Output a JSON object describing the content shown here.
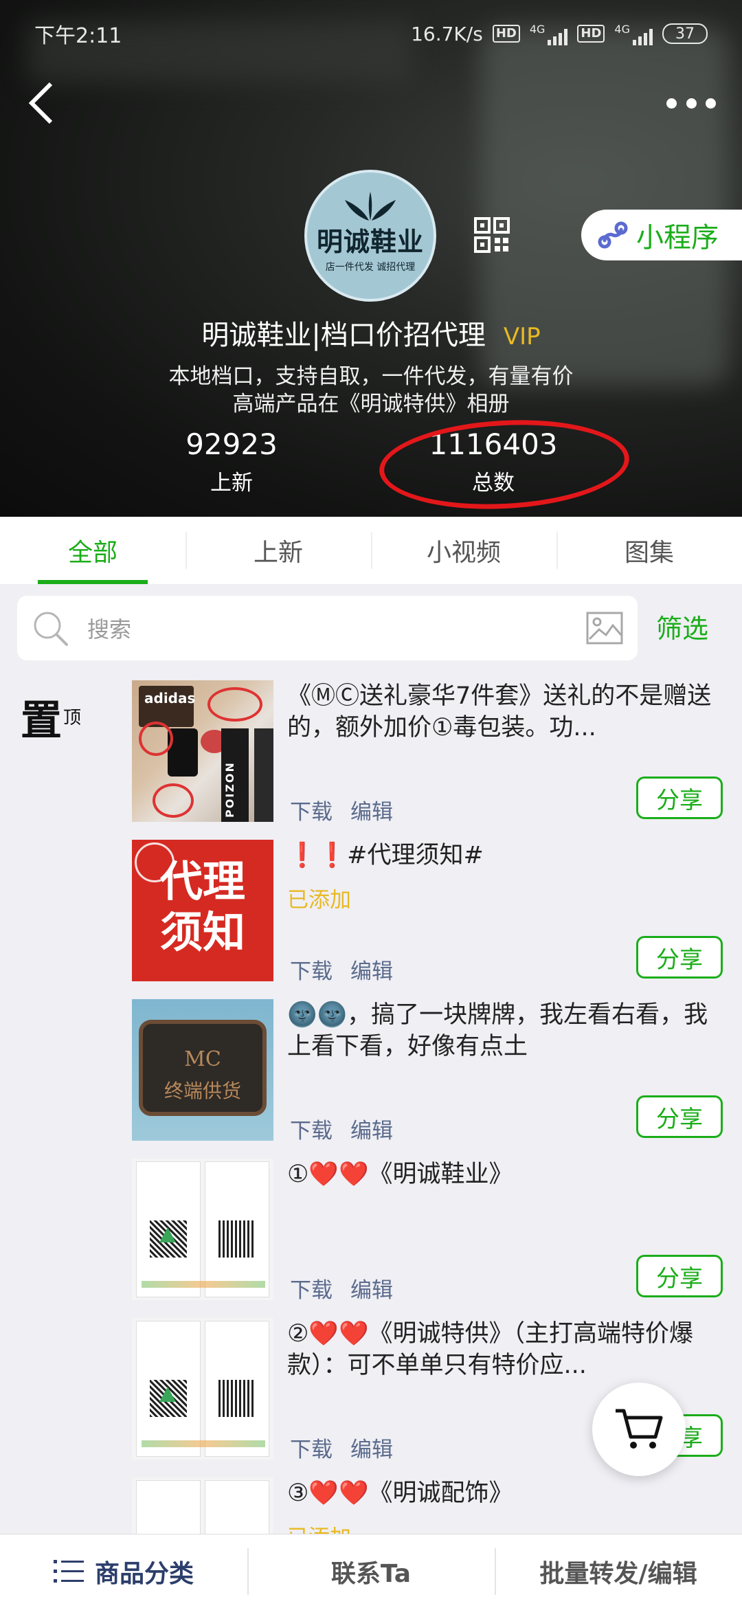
{
  "status_bar": {
    "time": "下午2:11",
    "net_speed": "16.7K/s",
    "hd1": "HD",
    "net1": "4G",
    "hd2": "HD",
    "net2": "4G",
    "battery": "37"
  },
  "shop": {
    "logo_name": "明诚鞋业",
    "logo_sub": "店一件代发   诚招代理",
    "name": "明诚鞋业|档口价招代理",
    "badge": "VIP",
    "desc_line1": "本地档口，支持自取，一件代发，有量有价",
    "desc_line2": "高端产品在《明诚特供》相册",
    "mini_program_label": "小程序"
  },
  "stats": [
    {
      "value": "92923",
      "label": "上新"
    },
    {
      "value": "1116403",
      "label": "总数"
    }
  ],
  "tabs": [
    {
      "label": "全部",
      "active": true
    },
    {
      "label": "上新",
      "active": false
    },
    {
      "label": "小视频",
      "active": false
    },
    {
      "label": "图集",
      "active": false
    }
  ],
  "search": {
    "placeholder": "搜索",
    "filter_label": "筛选"
  },
  "pin": {
    "big": "置",
    "small": "顶"
  },
  "items": [
    {
      "title": "《ⓂⒸ送礼豪华7件套》送礼的不是赠送的，额外加价①毒包装。功...",
      "added": "",
      "download": "下载",
      "edit": "编辑",
      "share": "分享"
    },
    {
      "title": "❗❗#代理须知#",
      "added": "已添加",
      "download": "下载",
      "edit": "编辑",
      "share": "分享"
    },
    {
      "title": "🌚🌚，搞了一块牌牌，我左看右看，我上看下看，好像有点土",
      "added": "",
      "download": "下载",
      "edit": "编辑",
      "share": "分享"
    },
    {
      "title": "①❤️❤️《明诚鞋业》",
      "added": "",
      "download": "下载",
      "edit": "编辑",
      "share": "分享"
    },
    {
      "title": "②❤️❤️《明诚特供》（主打高端特价爆款）：可不单单只有特价应...",
      "added": "",
      "download": "下载",
      "edit": "编辑",
      "share": "分享"
    },
    {
      "title": "③❤️❤️《明诚配饰》",
      "added": "已添加",
      "download": "",
      "edit": "",
      "share": ""
    }
  ],
  "thumb_texts": {
    "adidas": "adidas",
    "poizon": "POIZON",
    "notice_line1": "代理",
    "notice_line2": "须知",
    "plaque_line1": "MC",
    "plaque_line2": "终端供货"
  },
  "bottom_bar": {
    "categories": "商品分类",
    "contact": "联系Ta",
    "batch": "批量转发/编辑"
  },
  "colors": {
    "accent": "#1aad19",
    "vip": "#e8b923",
    "link": "#5b6b8c",
    "highlight_circle": "#e3171a"
  }
}
